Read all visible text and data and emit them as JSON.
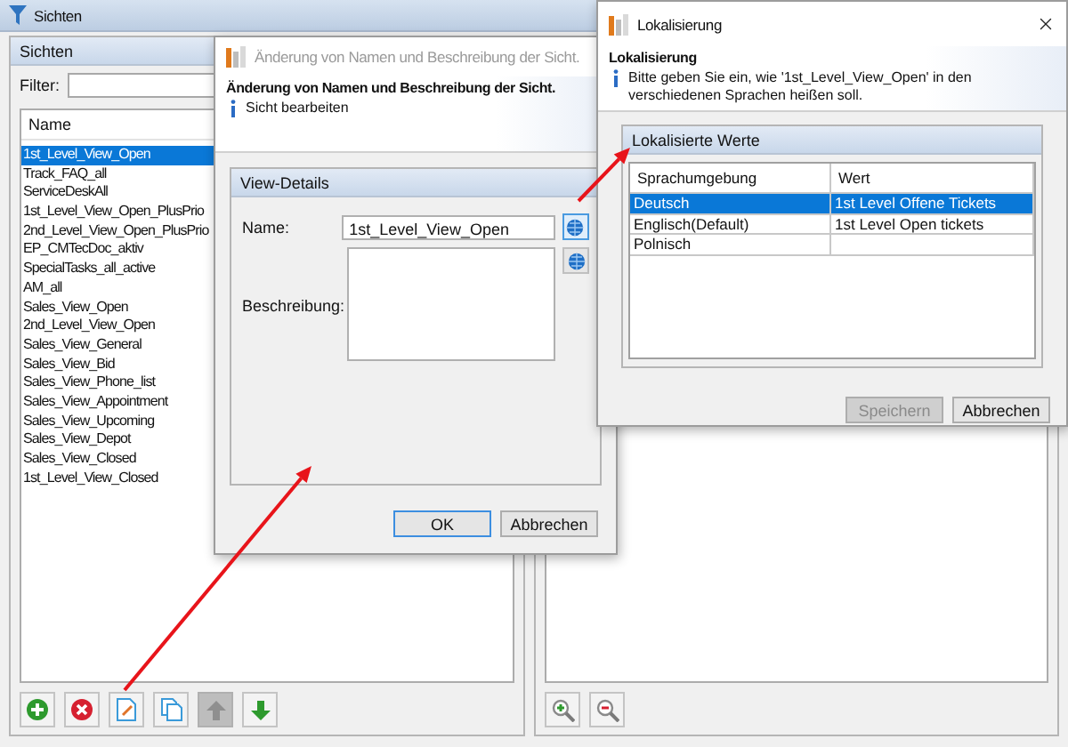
{
  "main_window": {
    "title": "Sichten",
    "views_panel": {
      "title": "Sichten",
      "filter_label": "Filter:",
      "column": "Name",
      "items": [
        {
          "label": "1st_Level_View_Open",
          "selected": true
        },
        {
          "label": "Track_FAQ_all",
          "selected": false
        },
        {
          "label": "ServiceDeskAll",
          "selected": false
        },
        {
          "label": "1st_Level_View_Open_PlusPrio",
          "selected": false
        },
        {
          "label": "2nd_Level_View_Open_PlusPrio",
          "selected": false
        },
        {
          "label": "EP_CMTecDoc_aktiv",
          "selected": false
        },
        {
          "label": "SpecialTasks_all_active",
          "selected": false
        },
        {
          "label": "AM_all",
          "selected": false
        },
        {
          "label": "Sales_View_Open",
          "selected": false
        },
        {
          "label": "2nd_Level_View_Open",
          "selected": false
        },
        {
          "label": "Sales_View_General",
          "selected": false
        },
        {
          "label": "Sales_View_Bid",
          "selected": false
        },
        {
          "label": "Sales_View_Phone_list",
          "selected": false
        },
        {
          "label": "Sales_View_Appointment",
          "selected": false
        },
        {
          "label": "Sales_View_Upcoming",
          "selected": false
        },
        {
          "label": "Sales_View_Depot",
          "selected": false
        },
        {
          "label": "Sales_View_Closed",
          "selected": false
        },
        {
          "label": "1st_Level_View_Closed",
          "selected": false
        }
      ],
      "toolbar": [
        {
          "kind": "add",
          "disabled": false
        },
        {
          "kind": "delete",
          "disabled": false
        },
        {
          "kind": "edit",
          "disabled": false
        },
        {
          "kind": "copy",
          "disabled": false
        },
        {
          "kind": "up",
          "disabled": true
        },
        {
          "kind": "down",
          "disabled": false
        }
      ]
    },
    "detail_panel": {
      "toolbar": [
        {
          "kind": "zoom_in",
          "disabled": false
        },
        {
          "kind": "zoom_out",
          "disabled": false
        }
      ]
    }
  },
  "edit_dialog": {
    "title": "Änderung von Namen und Beschreibung der Sicht.",
    "active": false,
    "heading": "Änderung von Namen und Beschreibung der Sicht.",
    "info": "Sicht bearbeiten",
    "group_title": "View-Details",
    "name_label": "Name:",
    "name_value": "1st_Level_View_Open",
    "description_label": "Beschreibung:",
    "buttons": [
      {
        "label": "OK",
        "default": true,
        "disabled": false
      },
      {
        "label": "Abbrechen",
        "default": false,
        "disabled": false
      }
    ]
  },
  "localization_dialog": {
    "title": "Lokalisierung",
    "active": true,
    "heading": "Lokalisierung",
    "info": "Bitte geben Sie ein, wie '1st_Level_View_Open' in den verschiedenen Sprachen heißen soll.",
    "group_title": "Lokalisierte Werte",
    "columns": [
      "Sprachumgebung",
      "Wert"
    ],
    "rows": [
      {
        "locale": "Deutsch",
        "value": "1st Level Offene Tickets",
        "selected": true
      },
      {
        "locale": "Englisch(Default)",
        "value": "1st Level Open tickets",
        "selected": false
      },
      {
        "locale": "Polnisch",
        "selected": false
      }
    ],
    "buttons": [
      {
        "label": "Speichern",
        "default": false,
        "disabled": true
      },
      {
        "label": "Abbrechen",
        "default": false,
        "disabled": false
      }
    ]
  }
}
